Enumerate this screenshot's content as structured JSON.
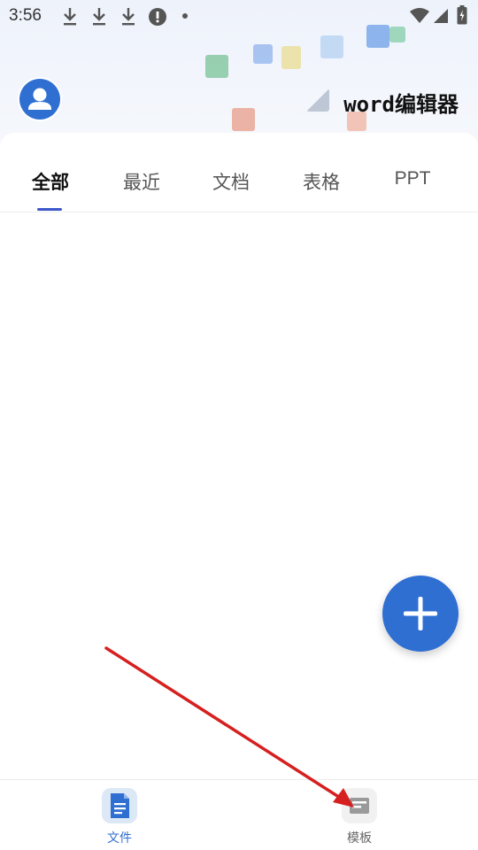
{
  "status_bar": {
    "time": "3:56",
    "icons": [
      "download-icon",
      "download-icon",
      "download-icon",
      "alert-icon",
      "dot-icon",
      "wifi-icon",
      "signal-icon",
      "battery-charging-icon"
    ]
  },
  "header": {
    "title": "word编辑器",
    "avatar_icon": "user-avatar-icon"
  },
  "tabs": [
    {
      "label": "全部",
      "active": true
    },
    {
      "label": "最近",
      "active": false
    },
    {
      "label": "文档",
      "active": false
    },
    {
      "label": "表格",
      "active": false
    },
    {
      "label": "PPT",
      "active": false
    }
  ],
  "fab": {
    "icon": "plus-icon"
  },
  "bottom_nav": [
    {
      "label": "文件",
      "icon": "document-icon",
      "active": true
    },
    {
      "label": "模板",
      "icon": "template-icon",
      "active": false
    }
  ],
  "colors": {
    "accent": "#2f6fd2",
    "tab_indicator": "#3b57c8",
    "annotation_arrow": "#d62020"
  }
}
